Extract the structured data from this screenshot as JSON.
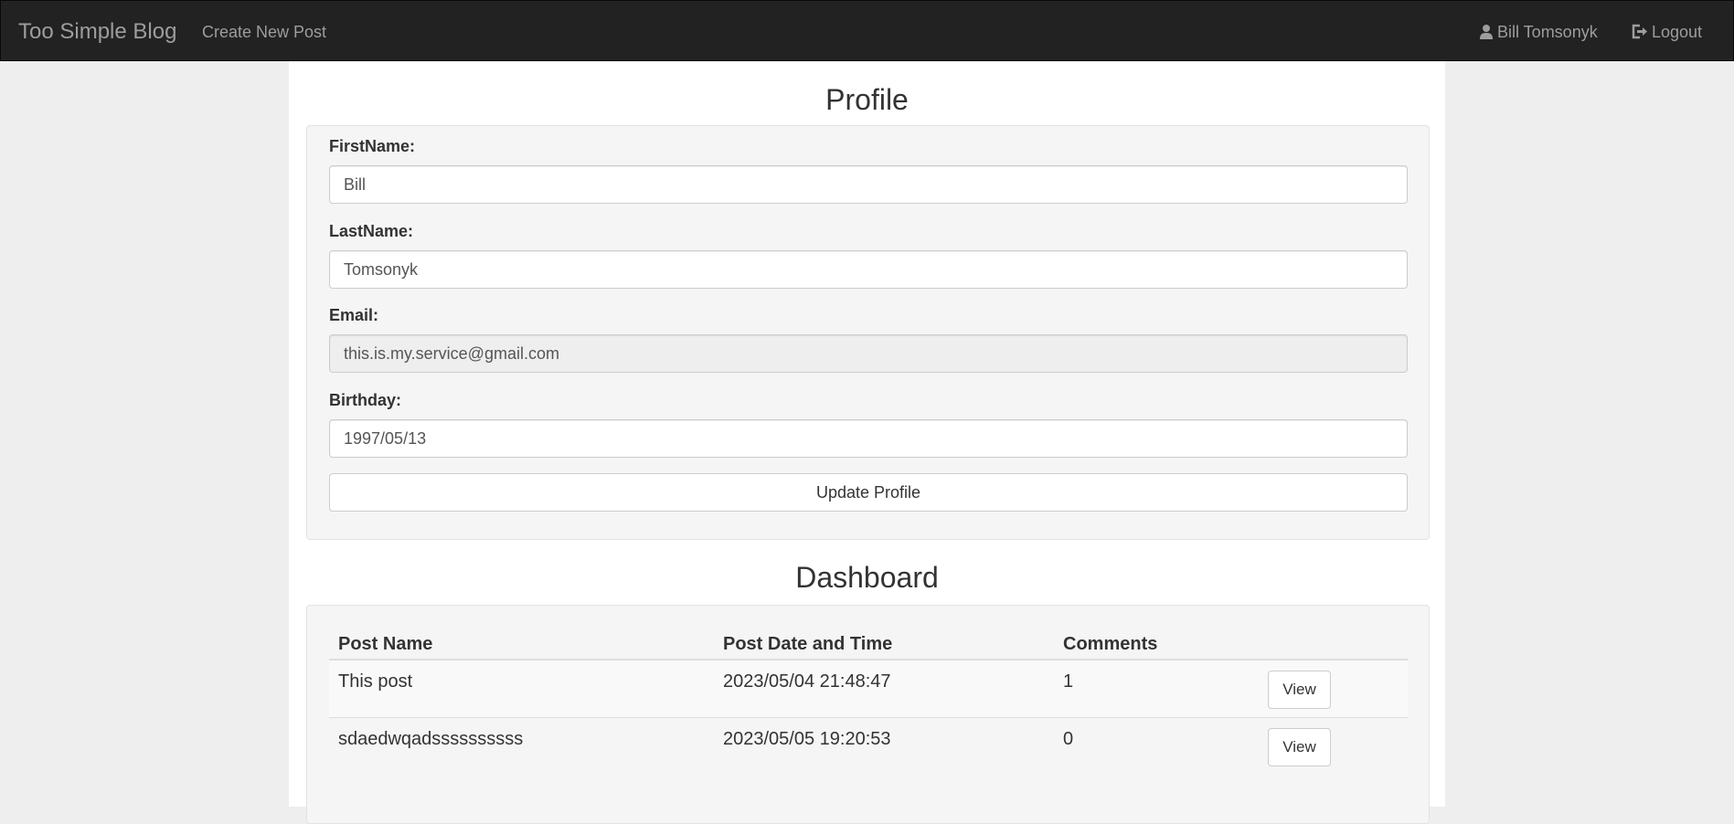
{
  "navbar": {
    "brand": "Too Simple Blog",
    "create_post": "Create New Post",
    "user_name": "Bill Tomsonyk",
    "logout": "Logout",
    "background": "#222222",
    "link_color": "#9d9d9d"
  },
  "profile": {
    "title": "Profile",
    "first_name_label": "FirstName:",
    "first_name_value": "Bill",
    "last_name_label": "LastName:",
    "last_name_value": "Tomsonyk",
    "email_label": "Email:",
    "email_value": "this.is.my.service@gmail.com",
    "birthday_label": "Birthday:",
    "birthday_value": "1997/05/13",
    "update_button": "Update Profile"
  },
  "dashboard": {
    "title": "Dashboard",
    "columns": [
      "Post Name",
      "Post Date and Time",
      "Comments"
    ],
    "rows": [
      {
        "name": "This post",
        "date": "2023/05/04 21:48:47",
        "comments": "1",
        "action": "View"
      },
      {
        "name": "sdaedwqadssssssssss",
        "date": "2023/05/05 19:20:53",
        "comments": "0",
        "action": "View"
      }
    ]
  },
  "icons": {
    "user": "user-icon",
    "logout": "logout-icon"
  }
}
